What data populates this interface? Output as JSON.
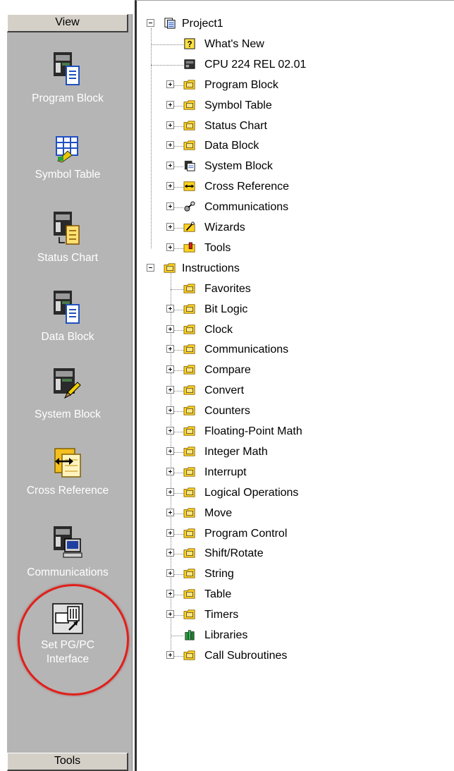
{
  "nav": {
    "view_label": "View",
    "tools_label": "Tools",
    "buttons": [
      {
        "label": "Program Block",
        "icon": "program-block-icon"
      },
      {
        "label": "Symbol Table",
        "icon": "symbol-table-icon"
      },
      {
        "label": "Status Chart",
        "icon": "status-chart-icon"
      },
      {
        "label": "Data Block",
        "icon": "data-block-icon"
      },
      {
        "label": "System Block",
        "icon": "system-block-icon"
      },
      {
        "label": "Cross Reference",
        "icon": "cross-reference-icon"
      },
      {
        "label": "Communications",
        "icon": "communications-icon"
      },
      {
        "label_line1": "Set PG/PC",
        "label_line2": "Interface",
        "icon": "set-pgpc-interface-icon"
      }
    ]
  },
  "tree": {
    "project": {
      "label": "Project1",
      "children": [
        {
          "label": "What's New",
          "icon": "whats-new-icon",
          "expandable": false
        },
        {
          "label": "CPU 224 REL 02.01",
          "icon": "cpu-icon",
          "expandable": false
        },
        {
          "label": "Program Block",
          "icon": "program-block-folder-icon",
          "expandable": true
        },
        {
          "label": "Symbol Table",
          "icon": "symbol-table-folder-icon",
          "expandable": true
        },
        {
          "label": "Status Chart",
          "icon": "status-chart-folder-icon",
          "expandable": true
        },
        {
          "label": "Data Block",
          "icon": "data-block-folder-icon",
          "expandable": true
        },
        {
          "label": "System Block",
          "icon": "system-block-folder-icon",
          "expandable": true
        },
        {
          "label": "Cross Reference",
          "icon": "cross-reference-folder-icon",
          "expandable": true
        },
        {
          "label": "Communications",
          "icon": "communications-folder-icon",
          "expandable": true
        },
        {
          "label": "Wizards",
          "icon": "wizards-folder-icon",
          "expandable": true
        },
        {
          "label": "Tools",
          "icon": "tools-folder-icon",
          "expandable": true
        }
      ]
    },
    "instructions": {
      "label": "Instructions",
      "children": [
        {
          "label": "Favorites",
          "icon": "favorites-icon",
          "expandable": false
        },
        {
          "label": "Bit Logic",
          "icon": "bit-logic-icon",
          "expandable": true
        },
        {
          "label": "Clock",
          "icon": "clock-icon",
          "expandable": true
        },
        {
          "label": "Communications",
          "icon": "communications-instr-icon",
          "expandable": true
        },
        {
          "label": "Compare",
          "icon": "compare-icon",
          "expandable": true
        },
        {
          "label": "Convert",
          "icon": "convert-icon",
          "expandable": true
        },
        {
          "label": "Counters",
          "icon": "counters-icon",
          "expandable": true
        },
        {
          "label": "Floating-Point Math",
          "icon": "floating-point-math-icon",
          "expandable": true
        },
        {
          "label": "Integer Math",
          "icon": "integer-math-icon",
          "expandable": true
        },
        {
          "label": "Interrupt",
          "icon": "interrupt-icon",
          "expandable": true
        },
        {
          "label": "Logical Operations",
          "icon": "logical-operations-icon",
          "expandable": true
        },
        {
          "label": "Move",
          "icon": "move-icon",
          "expandable": true
        },
        {
          "label": "Program Control",
          "icon": "program-control-icon",
          "expandable": true
        },
        {
          "label": "Shift/Rotate",
          "icon": "shift-rotate-icon",
          "expandable": true
        },
        {
          "label": "String",
          "icon": "string-icon",
          "expandable": true
        },
        {
          "label": "Table",
          "icon": "table-icon",
          "expandable": true
        },
        {
          "label": "Timers",
          "icon": "timers-icon",
          "expandable": true
        },
        {
          "label": "Libraries",
          "icon": "libraries-icon",
          "expandable": false
        },
        {
          "label": "Call Subroutines",
          "icon": "call-subroutines-icon",
          "expandable": true
        }
      ]
    }
  },
  "colors": {
    "nav_background": "#b5b5b5",
    "header_background": "#d4d0c8",
    "highlight_ring": "#e0201b",
    "folder_yellow": "#ffd21f"
  }
}
